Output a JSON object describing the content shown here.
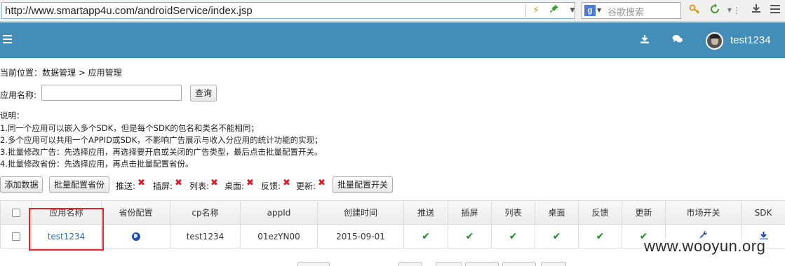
{
  "browser": {
    "url": "http://www.smartapp4u.com/androidService/index.jsp",
    "search_placeholder": "谷歌搜索",
    "search_engine_icon": "google-icon"
  },
  "header": {
    "username": "test1234",
    "bg_color": "#438eb9"
  },
  "breadcrumb": "当前位置：数据管理 > 应用管理",
  "search": {
    "label": "应用名称:",
    "value": "",
    "button": "查询"
  },
  "notes": [
    "说明：",
    "1.同一个应用可以嵌入多个SDK，但是每个SDK的包名和类名不能相同；",
    "2.多个应用可以共用一个APPID或SDK，不影响广告展示与收入分应用的统计功能的实现；",
    "3.批量修改广告：先选择应用，再选择要开启或关闭的广告类型，最后点击批量配置开关。",
    "4.批量修改省份：先选择应用，再点击批量配置省份。"
  ],
  "toolbar": {
    "add_button": "添加数据",
    "batch_province_button": "批量配置省份",
    "toggles": [
      {
        "label": "推送:"
      },
      {
        "label": "插屏:"
      },
      {
        "label": "列表:"
      },
      {
        "label": "桌面:"
      },
      {
        "label": "反馈:"
      },
      {
        "label": "更新:"
      }
    ],
    "batch_switch_button": "批量配置开关"
  },
  "table": {
    "headers": [
      "应用名称",
      "省份配置",
      "cp名称",
      "appId",
      "创建时间",
      "推送",
      "插屏",
      "列表",
      "桌面",
      "反馈",
      "更新",
      "市场开关",
      "SDK"
    ],
    "rows": [
      {
        "app_name": "test1234",
        "cp_name": "test1234",
        "app_id": "01ezYN00",
        "created": "2015-09-01"
      }
    ]
  },
  "watermark": "www.wooyun.org"
}
